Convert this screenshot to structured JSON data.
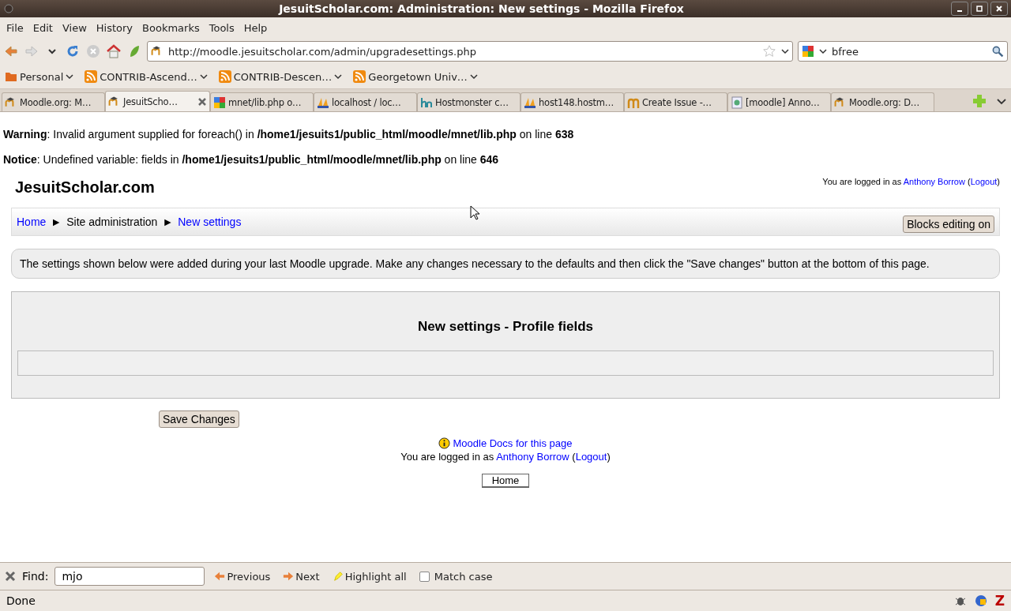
{
  "window": {
    "title": "JesuitScholar.com: Administration: New settings - Mozilla Firefox"
  },
  "menu": [
    "File",
    "Edit",
    "View",
    "History",
    "Bookmarks",
    "Tools",
    "Help"
  ],
  "url": "http://moodle.jesuitscholar.com/admin/upgradesettings.php",
  "search": {
    "value": "bfree"
  },
  "bookmarks": [
    {
      "label": "Personal",
      "kind": "folder"
    },
    {
      "label": "CONTRIB-Ascend…",
      "kind": "feed"
    },
    {
      "label": "CONTRIB-Descen…",
      "kind": "feed"
    },
    {
      "label": "Georgetown Univ…",
      "kind": "feed"
    }
  ],
  "tabs": [
    {
      "label": "Moodle.org: M…",
      "selected": false,
      "kind": "moodle"
    },
    {
      "label": "JesuitScho…",
      "selected": true,
      "kind": "moodle"
    },
    {
      "label": "mnet/lib.php o…",
      "selected": false,
      "kind": "google"
    },
    {
      "label": "localhost / loc…",
      "selected": false,
      "kind": "pma"
    },
    {
      "label": "Hostmonster c…",
      "selected": false,
      "kind": "hm"
    },
    {
      "label": "host148.hostm…",
      "selected": false,
      "kind": "pma"
    },
    {
      "label": "Create Issue -…",
      "selected": false,
      "kind": "m"
    },
    {
      "label": "[moodle] Anno…",
      "selected": false,
      "kind": "page"
    },
    {
      "label": "Moodle.org: D…",
      "selected": false,
      "kind": "moodle"
    }
  ],
  "messages": [
    "**Warning**: Invalid argument supplied for foreach() in **/home1/jesuits1/public_html/moodle/mnet/lib.php** on line **638**",
    "**Notice**: Undefined variable: fields in **/home1/jesuits1/public_html/moodle/mnet/lib.php** on line **646**"
  ],
  "site_title": "JesuitScholar.com",
  "login": {
    "prefix": "You are logged in as",
    "user": "Anthony Borrow",
    "logout": "Logout",
    "open": "(",
    "close": ")"
  },
  "breadcrumb": [
    {
      "label": "Home",
      "link": true
    },
    {
      "label": "Site administration",
      "link": false
    },
    {
      "label": "New settings",
      "link": true
    }
  ],
  "breadcrumb_separator": "►",
  "blocks_button": "Blocks editing on",
  "notice": "The settings shown below were added during your last Moodle upgrade. Make any changes necessary to the defaults and then click the \"Save changes\" button at the bottom of this page.",
  "section_title": "New settings - Profile fields",
  "save_button": "Save Changes",
  "docs_link": "Moodle Docs for this page",
  "footer_login": {
    "prefix": "You are logged in as",
    "user": "Anthony Borrow",
    "logout": "Logout",
    "open": "(",
    "close": ")"
  },
  "home_button": "Home",
  "find_bar": {
    "label": "Find:",
    "value": "mjo",
    "previous": "Previous",
    "next": "Next",
    "highlight": "Highlight all",
    "match_case": "Match case",
    "match_case_checked": false
  },
  "status_bar": {
    "text": "Done",
    "badge": "Z"
  }
}
